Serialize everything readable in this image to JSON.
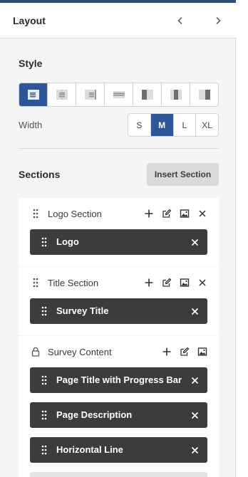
{
  "header": {
    "title": "Layout",
    "prev_icon": "chevron-left-icon",
    "next_icon": "chevron-right-icon"
  },
  "style": {
    "label": "Style",
    "alignment_options": [
      "align-left-icon",
      "align-center-icon",
      "align-right-icon",
      "align-full-icon",
      "layout-left-panel-icon",
      "layout-center-panel-icon",
      "layout-right-panel-icon"
    ],
    "selected_alignment": "align-left-icon",
    "width_label": "Width",
    "width_options": [
      "S",
      "M",
      "L",
      "XL"
    ],
    "selected_width": "M"
  },
  "sections": {
    "label": "Sections",
    "insert_label": "Insert Section",
    "list": [
      {
        "title": "Logo Section",
        "locked": false,
        "items": [
          "Logo"
        ]
      },
      {
        "title": "Title Section",
        "locked": false,
        "items": [
          "Survey Title"
        ]
      },
      {
        "title": "Survey Content",
        "locked": true,
        "items": [
          "Page Title with Progress Bar",
          "Page Description",
          "Horizontal Line"
        ]
      }
    ]
  },
  "colors": {
    "accent": "#2c5697",
    "top_bar": "#2c4e7e",
    "chip": "#3c3c3c",
    "panel": "#f5f5f6"
  }
}
